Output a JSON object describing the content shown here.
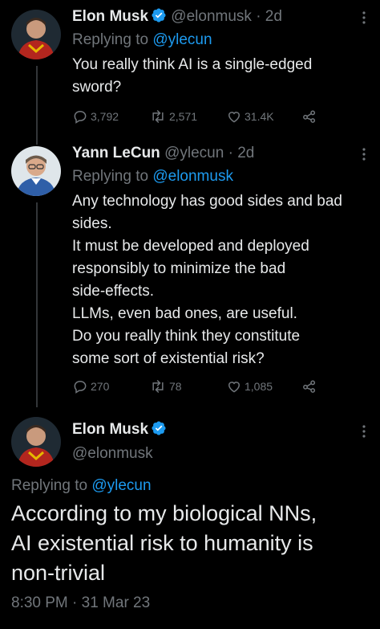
{
  "tweets": [
    {
      "name": "Elon Musk",
      "handle": "@elonmusk",
      "time": "2d",
      "replying_label": "Replying to",
      "replying_to": "@ylecun",
      "text_lines": [
        "You really think AI is a single-edged",
        "sword?"
      ],
      "stats": {
        "replies": "3,792",
        "retweets": "2,571",
        "likes": "31.4K"
      }
    },
    {
      "name": "Yann LeCun",
      "handle": "@ylecun",
      "time": "2d",
      "replying_label": "Replying to",
      "replying_to": "@elonmusk",
      "text_lines": [
        "Any technology has good sides and bad",
        "sides.",
        "It must be developed and deployed",
        "responsibly to minimize the bad",
        "side-effects.",
        "LLMs, even bad ones, are useful.",
        "Do you really think they constitute",
        "some sort of existential risk?"
      ],
      "stats": {
        "replies": "270",
        "retweets": "78",
        "likes": "1,085"
      }
    }
  ],
  "main_tweet": {
    "name": "Elon Musk",
    "handle": "@elonmusk",
    "replying_label": "Replying to",
    "replying_to": "@ylecun",
    "text_lines": [
      "According to my biological NNs,",
      "AI existential risk to humanity is",
      "non-trivial"
    ],
    "timestamp": "8:30 PM · 31 Mar 23"
  },
  "separator": "·",
  "colors": {
    "background": "#000000",
    "text": "#e7e9ea",
    "muted": "#71767b",
    "link": "#1d9bf0",
    "verified": "#1d9bf0"
  },
  "icons": [
    "verified-badge-icon",
    "more-icon",
    "reply-icon",
    "retweet-icon",
    "like-icon",
    "share-icon"
  ]
}
